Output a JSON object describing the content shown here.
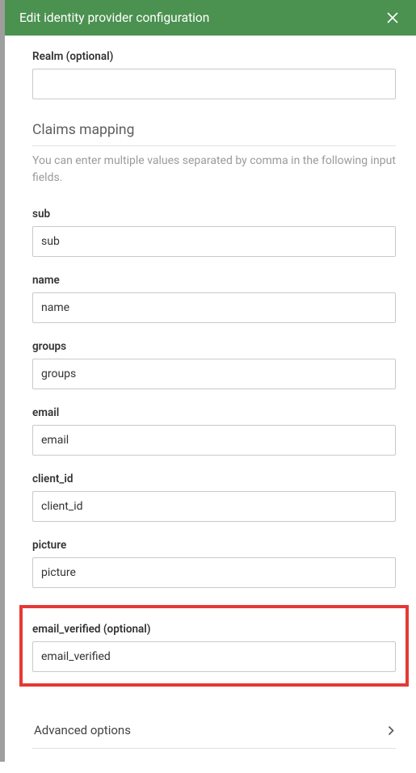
{
  "header": {
    "title": "Edit identity provider configuration",
    "close_label": "Close"
  },
  "realm": {
    "label": "Realm (optional)",
    "value": ""
  },
  "claims": {
    "section_title": "Claims mapping",
    "help_text": "You can enter multiple values separated by comma in the following input fields.",
    "fields": {
      "sub": {
        "label": "sub",
        "value": "sub"
      },
      "name": {
        "label": "name",
        "value": "name"
      },
      "groups": {
        "label": "groups",
        "value": "groups"
      },
      "email": {
        "label": "email",
        "value": "email"
      },
      "client_id": {
        "label": "client_id",
        "value": "client_id"
      },
      "picture": {
        "label": "picture",
        "value": "picture"
      },
      "email_verified": {
        "label": "email_verified (optional)",
        "value": "email_verified"
      }
    }
  },
  "advanced": {
    "label": "Advanced options"
  }
}
